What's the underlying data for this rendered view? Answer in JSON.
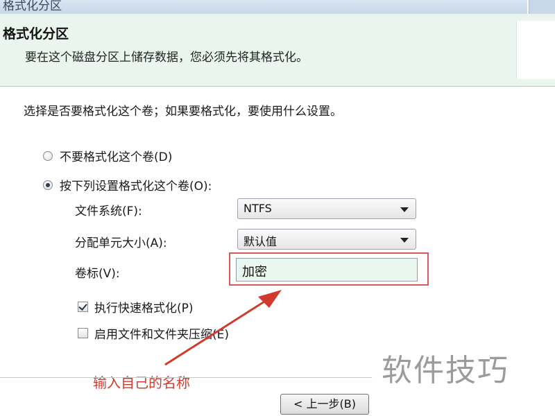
{
  "window": {
    "title_fragment": "格式化分区"
  },
  "header": {
    "title": "格式化分区",
    "subtitle": "要在这个磁盘分区上储存数据，您必须先将其格式化。"
  },
  "main": {
    "instruction": "选择是否要格式化这个卷；如果要格式化，要使用什么设置。",
    "options": [
      {
        "label": "不要格式化这个卷(D)",
        "checked": false
      },
      {
        "label": "按下列设置格式化这个卷(O):",
        "checked": true
      }
    ],
    "file_system": {
      "label": "文件系统(F):",
      "value": "NTFS"
    },
    "allocation_unit": {
      "label": "分配单元大小(A):",
      "value": "默认值"
    },
    "volume_label": {
      "label": "卷标(V):",
      "value": "加密"
    },
    "quick_format": {
      "label": "执行快速格式化(P)",
      "checked": true
    },
    "compression": {
      "label": "启用文件和文件夹压缩(E)",
      "checked": false
    }
  },
  "annotation": {
    "text": "输入自己的名称",
    "color": "#d23a2e"
  },
  "footer": {
    "back_label": "< 上一步(B)"
  },
  "watermark": {
    "text": "软件技巧"
  },
  "colors": {
    "header_bg": "#e9f5ee",
    "input_bg": "#e9f7ee",
    "highlight": "#d65a5a"
  }
}
